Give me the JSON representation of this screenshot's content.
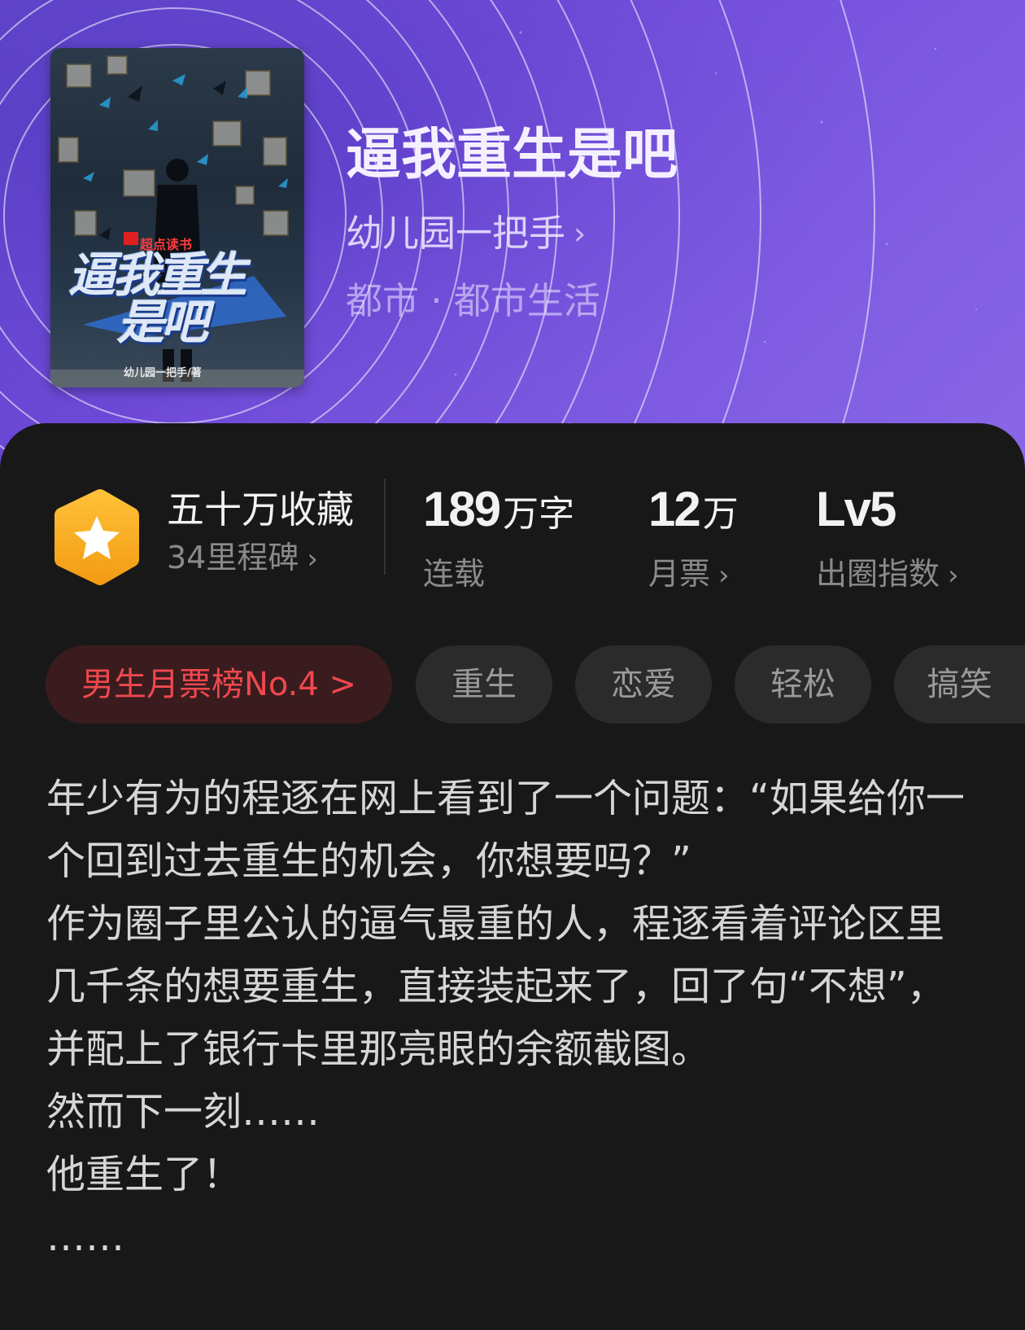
{
  "book": {
    "title": "逼我重生是吧",
    "author": "幼儿园一把手",
    "genre": "都市 · 都市生活"
  },
  "cover": {
    "brand": "超点读书",
    "title_line1": "逼我重生",
    "title_line2": "是吧",
    "author": "幼儿园一把手/著"
  },
  "stats": {
    "collect": {
      "title": "五十万收藏",
      "subtitle": "34里程碑"
    },
    "words": {
      "value": "189",
      "unit": "万字",
      "label": "连载"
    },
    "tickets": {
      "value": "12",
      "unit": "万",
      "label": "月票"
    },
    "level": {
      "value": "Lv5",
      "label": "出圈指数"
    }
  },
  "tags": {
    "rank": "男生月票榜No.4 >",
    "items": [
      "重生",
      "恋爱",
      "轻松",
      "搞笑"
    ]
  },
  "synopsis": {
    "paragraphs": [
      "年少有为的程逐在网上看到了一个问题：“如果给你一个回到过去重生的机会，你想要吗？”",
      "作为圈子里公认的逼气最重的人，程逐看着评论区里几千条的想要重生，直接装起来了，回了句“不想”，并配上了银行卡里那亮眼的余额截图。",
      "然而下一刻……",
      "他重生了！",
      "……"
    ]
  },
  "colors": {
    "header_purple": "#6b45d6",
    "panel_bg": "#181818",
    "rank_red": "#f0484e",
    "badge_orange": "#f7a21b"
  },
  "icons": {
    "badge": "star-hexagon-icon",
    "chevron": "chevron-right-icon"
  }
}
